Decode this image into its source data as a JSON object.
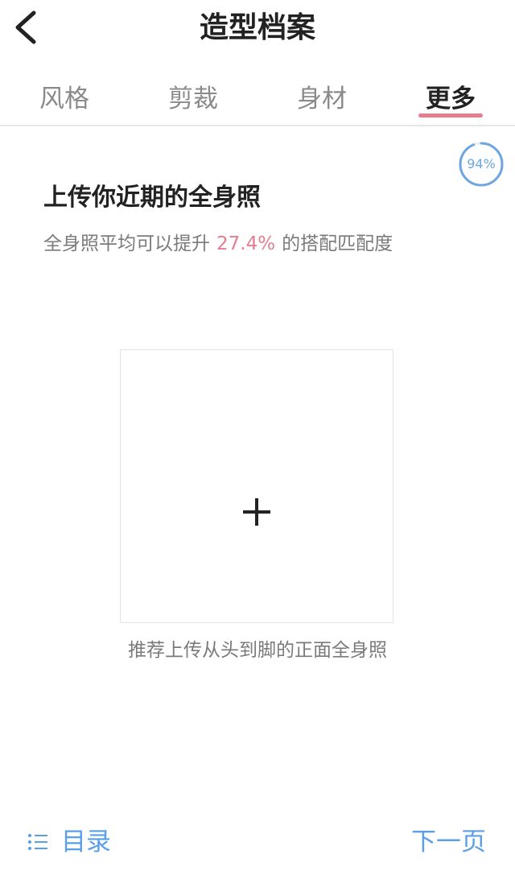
{
  "header": {
    "title": "造型档案"
  },
  "tabs": [
    {
      "label": "风格",
      "active": false
    },
    {
      "label": "剪裁",
      "active": false
    },
    {
      "label": "身材",
      "active": false
    },
    {
      "label": "更多",
      "active": true
    }
  ],
  "progress": {
    "value": 0.94,
    "label": "94%",
    "color": "#6ea6e2"
  },
  "content": {
    "heading": "上传你近期的全身照",
    "subtext_before": "全身照平均可以提升",
    "subtext_highlight": "27.4%",
    "subtext_after": "的搭配匹配度",
    "highlight_color": "#e47e8f",
    "upload_icon": "plus-icon",
    "upload_hint": "推荐上传从头到脚的正面全身照"
  },
  "footer": {
    "toc_icon": "list-icon",
    "toc_label": "目录",
    "next_label": "下一页",
    "link_color": "#5aa0e8"
  }
}
